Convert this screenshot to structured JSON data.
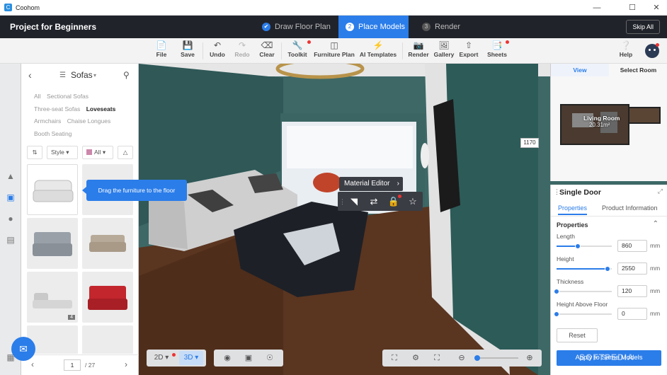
{
  "app": {
    "title": "Coohom"
  },
  "header": {
    "project_title": "Project for Beginners",
    "steps": [
      {
        "num": "✔",
        "label": "Draw Floor Plan"
      },
      {
        "num": "2",
        "label": "Place Models"
      },
      {
        "num": "3",
        "label": "Render"
      }
    ],
    "skip_label": "Skip All"
  },
  "toolbar": {
    "file": "File",
    "save": "Save",
    "undo": "Undo",
    "redo": "Redo",
    "clear": "Clear",
    "toolkit": "Toolkit",
    "furniture_plan": "Furniture Plan",
    "ai_templates": "AI Templates",
    "render": "Render",
    "gallery": "Gallery",
    "export": "Export",
    "sheets": "Sheets",
    "help": "Help"
  },
  "catalog": {
    "category": "Sofas",
    "subcategories": [
      "All",
      "Sectional Sofas",
      "Three-seat Sofas",
      "Loveseats",
      "Armchairs",
      "Chaise Longues",
      "Booth Seating"
    ],
    "selected_subcategory": "Loveseats",
    "filter_style": "Style",
    "filter_color": "All",
    "badge_count": "4",
    "page_current": "1",
    "page_total": "/ 27"
  },
  "tooltip": {
    "drag": "Drag the furniture to the floor"
  },
  "material_editor": {
    "label": "Material Editor"
  },
  "scene": {
    "dimension_label": "1170"
  },
  "minimap": {
    "tab_view": "View",
    "tab_select": "Select Room",
    "room_name": "Living Room",
    "room_area": "20.31m²"
  },
  "properties": {
    "title": "Single Door",
    "tab_properties": "Properties",
    "tab_product_info": "Product Information",
    "section_title": "Properties",
    "fields": [
      {
        "label": "Length",
        "value": "860",
        "unit": "mm",
        "level": 0.38
      },
      {
        "label": "Height",
        "value": "2550",
        "unit": "mm",
        "level": 0.92
      },
      {
        "label": "Thickness",
        "value": "120",
        "unit": "mm",
        "level": 0.0
      },
      {
        "label": "Height Above Floor",
        "value": "0",
        "unit": "mm",
        "level": 0.0
      }
    ],
    "reset_label": "Reset",
    "apply_label": "Apply to Same Models"
  },
  "view_controls": {
    "mode_2d": "2D",
    "mode_3d": "3D"
  },
  "watermark": "SOFTPEDIA",
  "colors": {
    "accent": "#2b7de9",
    "header_bg": "#20232a",
    "wall": "#3a6462",
    "floor": "#5a3520"
  }
}
